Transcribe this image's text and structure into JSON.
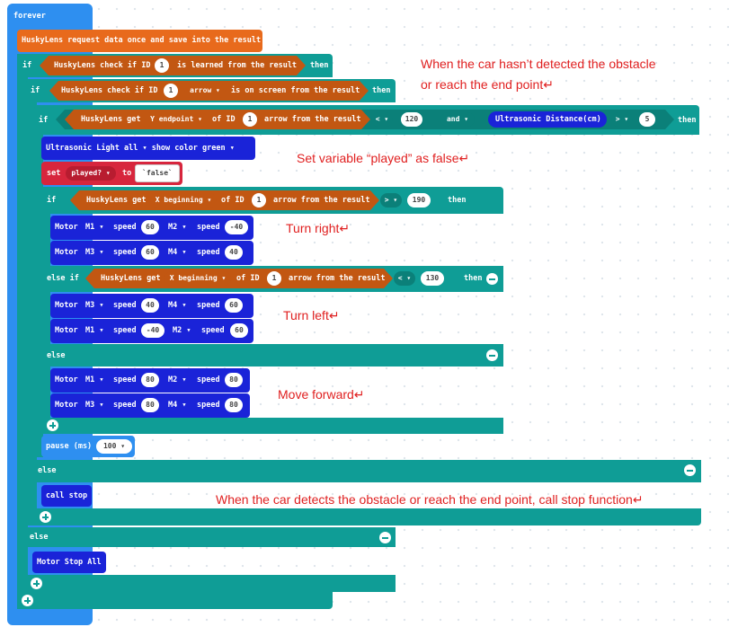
{
  "blocks": {
    "forever": "forever",
    "request": "HuskyLens request data once and save into the result",
    "if": "if",
    "then": "then",
    "else": "else",
    "else_if": "else if",
    "check_learned": "HuskyLens check if ID",
    "check_learned_tail": "is learned from the result",
    "check_screen": "HuskyLens check if ID",
    "arrow": "arrow ▾",
    "check_screen_tail": "is on screen from the result",
    "get": "HuskyLens get",
    "y_endpoint": "Y endpoint ▾",
    "x_beginning": "X beginning ▾",
    "of_id": "of ID",
    "arrow_from_result": "arrow from the result",
    "lt": "< ▾",
    "gt": "> ▾",
    "and": "and ▾",
    "ultrasonic": "Ultrasonic Distance(cm)",
    "ultra_light": "Ultrasonic Light  all ▾  show color  green ▾",
    "set": "set",
    "played_var": "played? ▾",
    "to": "to",
    "false_val": "`false`",
    "id_val": "1",
    "v120": "120",
    "v5": "5",
    "v190": "190",
    "v130": "130",
    "motor": "Motor",
    "m1": "M1 ▾",
    "m2": "M2 ▾",
    "m3": "M3 ▾",
    "m4": "M4 ▾",
    "speed": "speed",
    "s60": "60",
    "s_neg40": "-40",
    "s40": "40",
    "s80": "80",
    "pause": "pause (ms)",
    "pause_val": "100 ▾",
    "call_stop": "call stop",
    "motor_stop_all": "Motor Stop All"
  },
  "annotations": {
    "a1_line1": "When the car hasn’t detected the obstacle",
    "a1_line2": "or reach the end point↵",
    "a2": "Set variable “played” as false↵",
    "a3": "Turn right↵",
    "a4": "Turn left↵",
    "a5": "Move forward↵",
    "a6": "When the car detects the obstacle or reach the end point, call stop function↵"
  },
  "colors": {
    "loop": "#2e8ff0",
    "logic": "#0f9d96",
    "huskylens": "#e86a1c",
    "motor": "#1a23d8",
    "variable": "#d7263d",
    "annotation": "#e02020"
  }
}
